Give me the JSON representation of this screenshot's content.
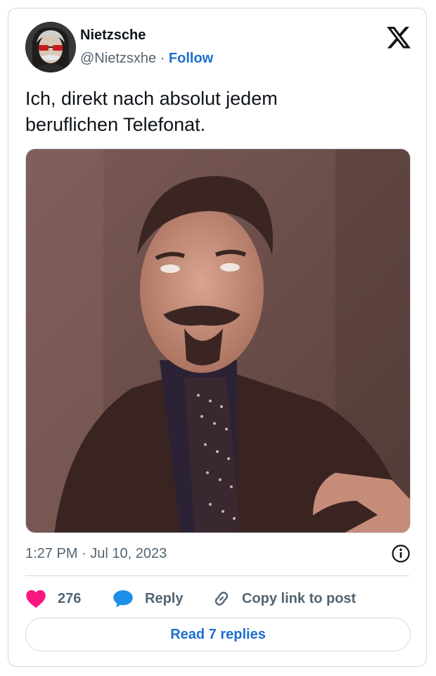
{
  "author": {
    "name": "Nietzsche",
    "handle": "@Nietzsxhe",
    "separator": "·",
    "follow_label": "Follow"
  },
  "tweet": {
    "text_line1": "Ich, direkt nach absolut jedem",
    "text_line2": "beruflichen Telefonat.",
    "timestamp": "1:27 PM · Jul 10, 2023"
  },
  "actions": {
    "likes_count": "276",
    "reply_label": "Reply",
    "copy_link_label": "Copy link to post",
    "read_replies_label": "Read 7 replies"
  },
  "colors": {
    "accent_blue": "#1d6fcc",
    "like_pink": "#f91880",
    "text_secondary": "#536471"
  },
  "icons": {
    "brand": "x-logo-icon",
    "info": "info-icon",
    "like": "heart-icon",
    "reply": "speech-bubble-icon",
    "link": "link-icon"
  }
}
